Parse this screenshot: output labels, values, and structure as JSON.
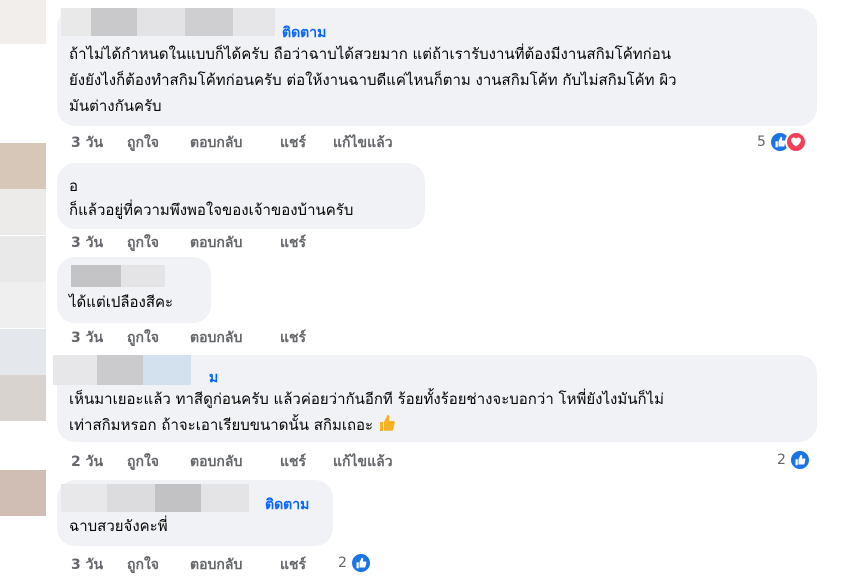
{
  "colors": {
    "bubble_bg": "#f0f2f5",
    "link_blue": "#0866ff",
    "meta_gray": "#65676b",
    "like_blue": "#1b74e4",
    "love_red": "#f33e58"
  },
  "comments": [
    {
      "follow_label": "ติดตาม",
      "lines": [
        "ถ้าไม่ได้กำหนดในแบบก็ได้ครับ ถือว่าฉาบได้สวยมาก แต่ถ้าเรารับงานที่ต้องมีงานสกิมโค้ทก่อน",
        "ยังยังไงก็ต้องทำสกิมโค้ทก่อนครับ ต่อให้งานฉาบดีแค่ไหนก็ตาม งานสกิมโค้ท กับไม่สกิมโค้ท ผิว",
        "มันต่างกันครับ"
      ],
      "actions": {
        "time": "3 วัน",
        "like": "ถูกใจ",
        "reply": "ตอบกลับ",
        "share": "แชร์",
        "edited": "แก้ไขแล้ว"
      },
      "reaction_count": "5",
      "reaction_icons": [
        "like-icon",
        "love-icon"
      ]
    },
    {
      "lines": [
        "อ",
        "ก็แล้วอยู่ที่ความพึงพอใจของเจ้าของบ้านครับ"
      ],
      "actions": {
        "time": "3 วัน",
        "like": "ถูกใจ",
        "reply": "ตอบกลับ",
        "share": "แชร์"
      }
    },
    {
      "lines": [
        "ได้แต่เปลืองสีคะ"
      ],
      "actions": {
        "time": "3 วัน",
        "like": "ถูกใจ",
        "reply": "ตอบกลับ",
        "share": "แชร์"
      }
    },
    {
      "name_suffix": "ม",
      "lines": [
        "เห็นมาเยอะแล้ว ทาสีดูก่อนครับ แล้วค่อยว่ากันอีกที ร้อยทั้งร้อยช่างจะบอกว่า โหพี่ยังไงมันก็ไม่",
        "เท่าสกิมหรอก ถ้าจะเอาเรียบขนาดนั้น สกิมเถอะ"
      ],
      "emoji": "thumbs-up-emoji",
      "actions": {
        "time": "2 วัน",
        "like": "ถูกใจ",
        "reply": "ตอบกลับ",
        "share": "แชร์",
        "edited": "แก้ไขแล้ว"
      },
      "reaction_count": "2",
      "reaction_icons": [
        "like-icon"
      ]
    },
    {
      "follow_label": "ติดตาม",
      "lines": [
        "ฉาบสวยจังคะพี่"
      ],
      "actions": {
        "time": "3 วัน",
        "like": "ถูกใจ",
        "reply": "ตอบกลับ",
        "share": "แชร์"
      },
      "reaction_count": "2",
      "reaction_icons": [
        "like-icon"
      ]
    }
  ]
}
